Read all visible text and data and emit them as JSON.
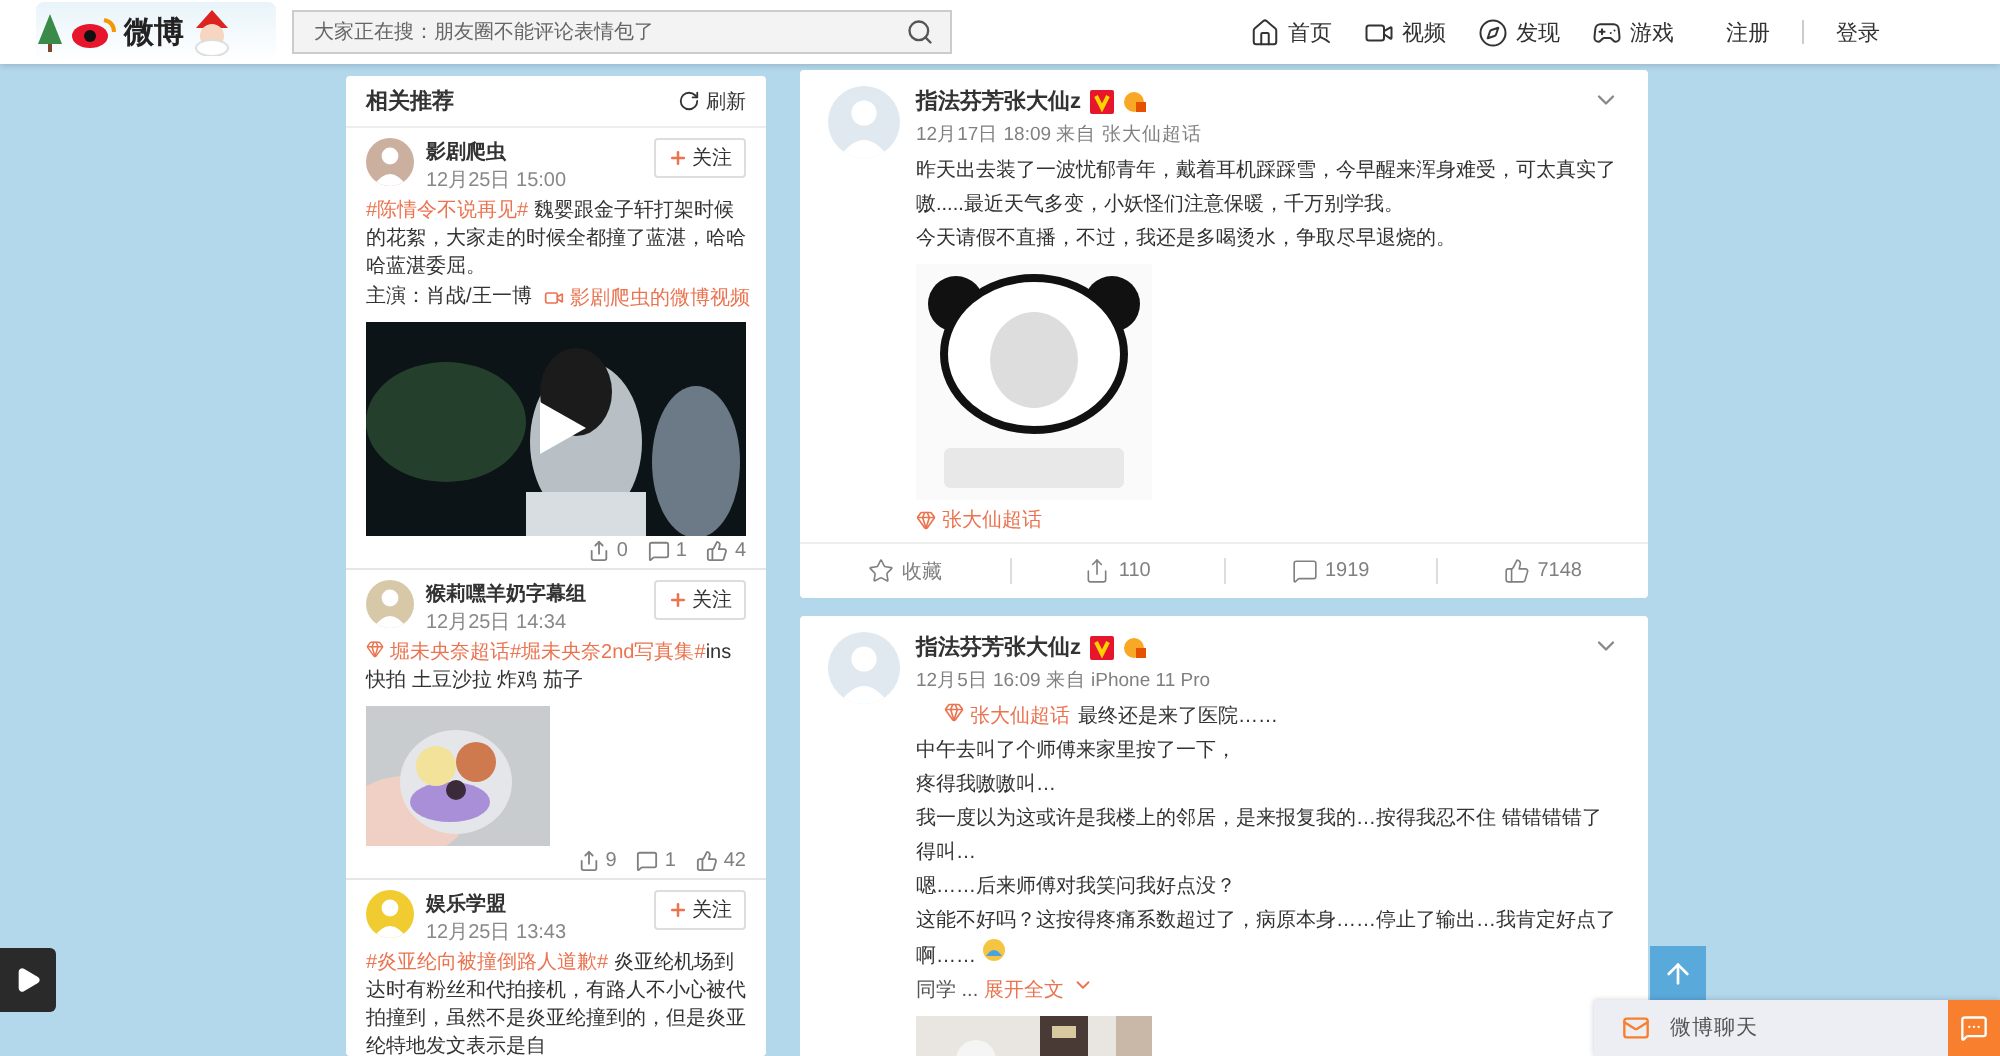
{
  "header": {
    "logo": "微博",
    "search": {
      "placeholder": "大家正在搜：朋友圈不能评论表情包了"
    },
    "nav": [
      {
        "label": "首页",
        "kind": "home"
      },
      {
        "label": "视频",
        "kind": "video"
      },
      {
        "label": "发现",
        "kind": "discover"
      },
      {
        "label": "游戏",
        "kind": "game"
      }
    ],
    "auth": [
      "注册",
      "登录"
    ]
  },
  "sidebar": {
    "title": "相关推荐",
    "refresh": "刷新",
    "items": [
      {
        "kind": "video",
        "name": "影剧爬虫",
        "time": "12月25日 15:00",
        "follow": "关注",
        "topic": "#陈情令不说再见#",
        "text": " 魏婴跟金子轩打架时候的花絮，大家走的时候全都撞了蓝湛，哈哈哈蓝湛委屈。",
        "cast": "主演：肖战/王一博",
        "video_link": "影剧爬虫的微博视频",
        "topic_icon": false,
        "reposts": "0",
        "comments": "1",
        "likes": "4"
      },
      {
        "name": "猴莉嘿羊奶字幕组",
        "time": "12月25日 14:34",
        "follow": "关注",
        "topic": "堀未央奈超话#堀未央奈2nd写真集#",
        "text": "ins 快拍 土豆沙拉 炸鸡 茄子",
        "topic_icon": true,
        "reposts": "9",
        "comments": "1",
        "likes": "42"
      },
      {
        "kind": "text",
        "name": "娱乐学盟",
        "time": "12月25日 13:43",
        "follow": "关注",
        "topic": "#炎亚纶向被撞倒路人道歉#",
        "text": " 炎亚纶机场到达时有粉丝和代拍接机，有路人不小心被代拍撞到，虽然不是炎亚纶撞到的，但是炎亚纶特地发文表示是自",
        "topic_icon": false
      }
    ]
  },
  "posts": [
    {
      "author": "指法芬芳张大仙z",
      "meta": "12月17日 18:09 来自 张大仙超话",
      "lines": [
        "昨天出去装了一波忧郁青年，戴着耳机踩踩雪，今早醒来浑身难受，可太真实了嗷.....最近天气多变，小妖怪们注意保暖，千万别学我。",
        "今天请假不直播，不过，我还是多喝烫水，争取尽早退烧的。"
      ],
      "tag": "张大仙超话",
      "actions": [
        {
          "kind": "favorite",
          "label": "收藏"
        },
        {
          "kind": "repost",
          "label": "110"
        },
        {
          "kind": "comment",
          "label": "1919"
        },
        {
          "kind": "like",
          "label": "7148"
        }
      ]
    },
    {
      "author": "指法芬芳张大仙z",
      "meta": "12月5日 16:09 来自 iPhone 11 Pro",
      "lead_topic": "张大仙超话",
      "lines": [
        "最终还是来了医院……",
        "中午去叫了个师傅来家里按了一下，",
        "疼得我嗷嗷叫…",
        "我一度以为这或许是我楼上的邻居，是来报复我的…按得我忍不住 错错错错了得叫…",
        "嗯……后来师傅对我笑问我好点没？",
        "这能不好吗？这按得疼痛系数超过了，病原本身……停止了输出…我肯定好点了啊……"
      ],
      "more": {
        "prefix": "同学 ...",
        "link": "展开全文"
      }
    }
  ],
  "chat": {
    "label": "微博聊天"
  }
}
